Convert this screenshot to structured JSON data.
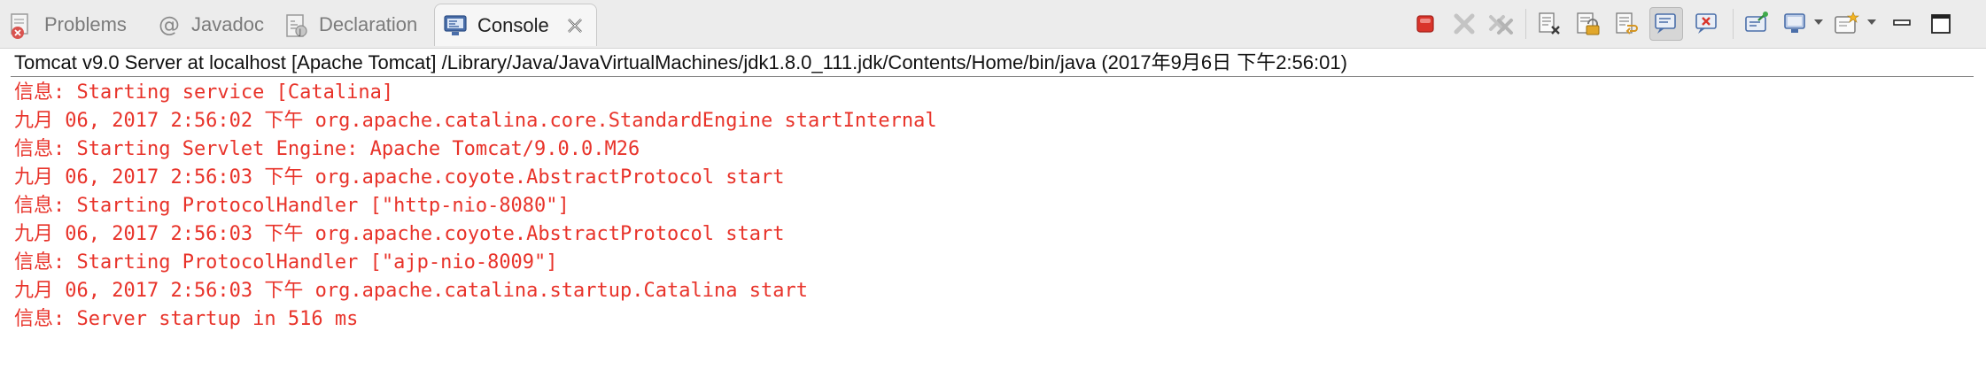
{
  "tabs": [
    {
      "label": "Problems",
      "icon": "problems-icon",
      "active": false
    },
    {
      "label": "Javadoc",
      "icon": "javadoc-at-icon",
      "active": false
    },
    {
      "label": "Declaration",
      "icon": "declaration-icon",
      "active": false
    },
    {
      "label": "Console",
      "icon": "console-icon",
      "active": true
    }
  ],
  "toolbar": [
    "terminate-icon",
    "remove-launch-icon",
    "remove-all-terminated-icon",
    "clear-console-icon",
    "scroll-lock-icon",
    "word-wrap-icon",
    "show-console-on-stdout-icon",
    "show-console-on-stderr-icon",
    "pin-console-icon",
    "display-selected-console-icon",
    "open-console-icon",
    "minimize-icon",
    "maximize-icon"
  ],
  "console": {
    "description": "Tomcat v9.0 Server at localhost [Apache Tomcat] /Library/Java/JavaVirtualMachines/jdk1.8.0_111.jdk/Contents/Home/bin/java (2017年9月6日 下午2:56:01)",
    "lines": [
      "信息: Starting service [Catalina]",
      "九月 06, 2017 2:56:02 下午 org.apache.catalina.core.StandardEngine startInternal",
      "信息: Starting Servlet Engine: Apache Tomcat/9.0.0.M26",
      "九月 06, 2017 2:56:03 下午 org.apache.coyote.AbstractProtocol start",
      "信息: Starting ProtocolHandler [\"http-nio-8080\"]",
      "九月 06, 2017 2:56:03 下午 org.apache.coyote.AbstractProtocol start",
      "信息: Starting ProtocolHandler [\"ajp-nio-8009\"]",
      "九月 06, 2017 2:56:03 下午 org.apache.catalina.startup.Catalina start",
      "信息: Server startup in 516 ms"
    ]
  },
  "colors": {
    "stderr_text": "#e8332a",
    "tabbar_bg": "#ececec",
    "active_tab_bg": "#f6f6f6"
  }
}
